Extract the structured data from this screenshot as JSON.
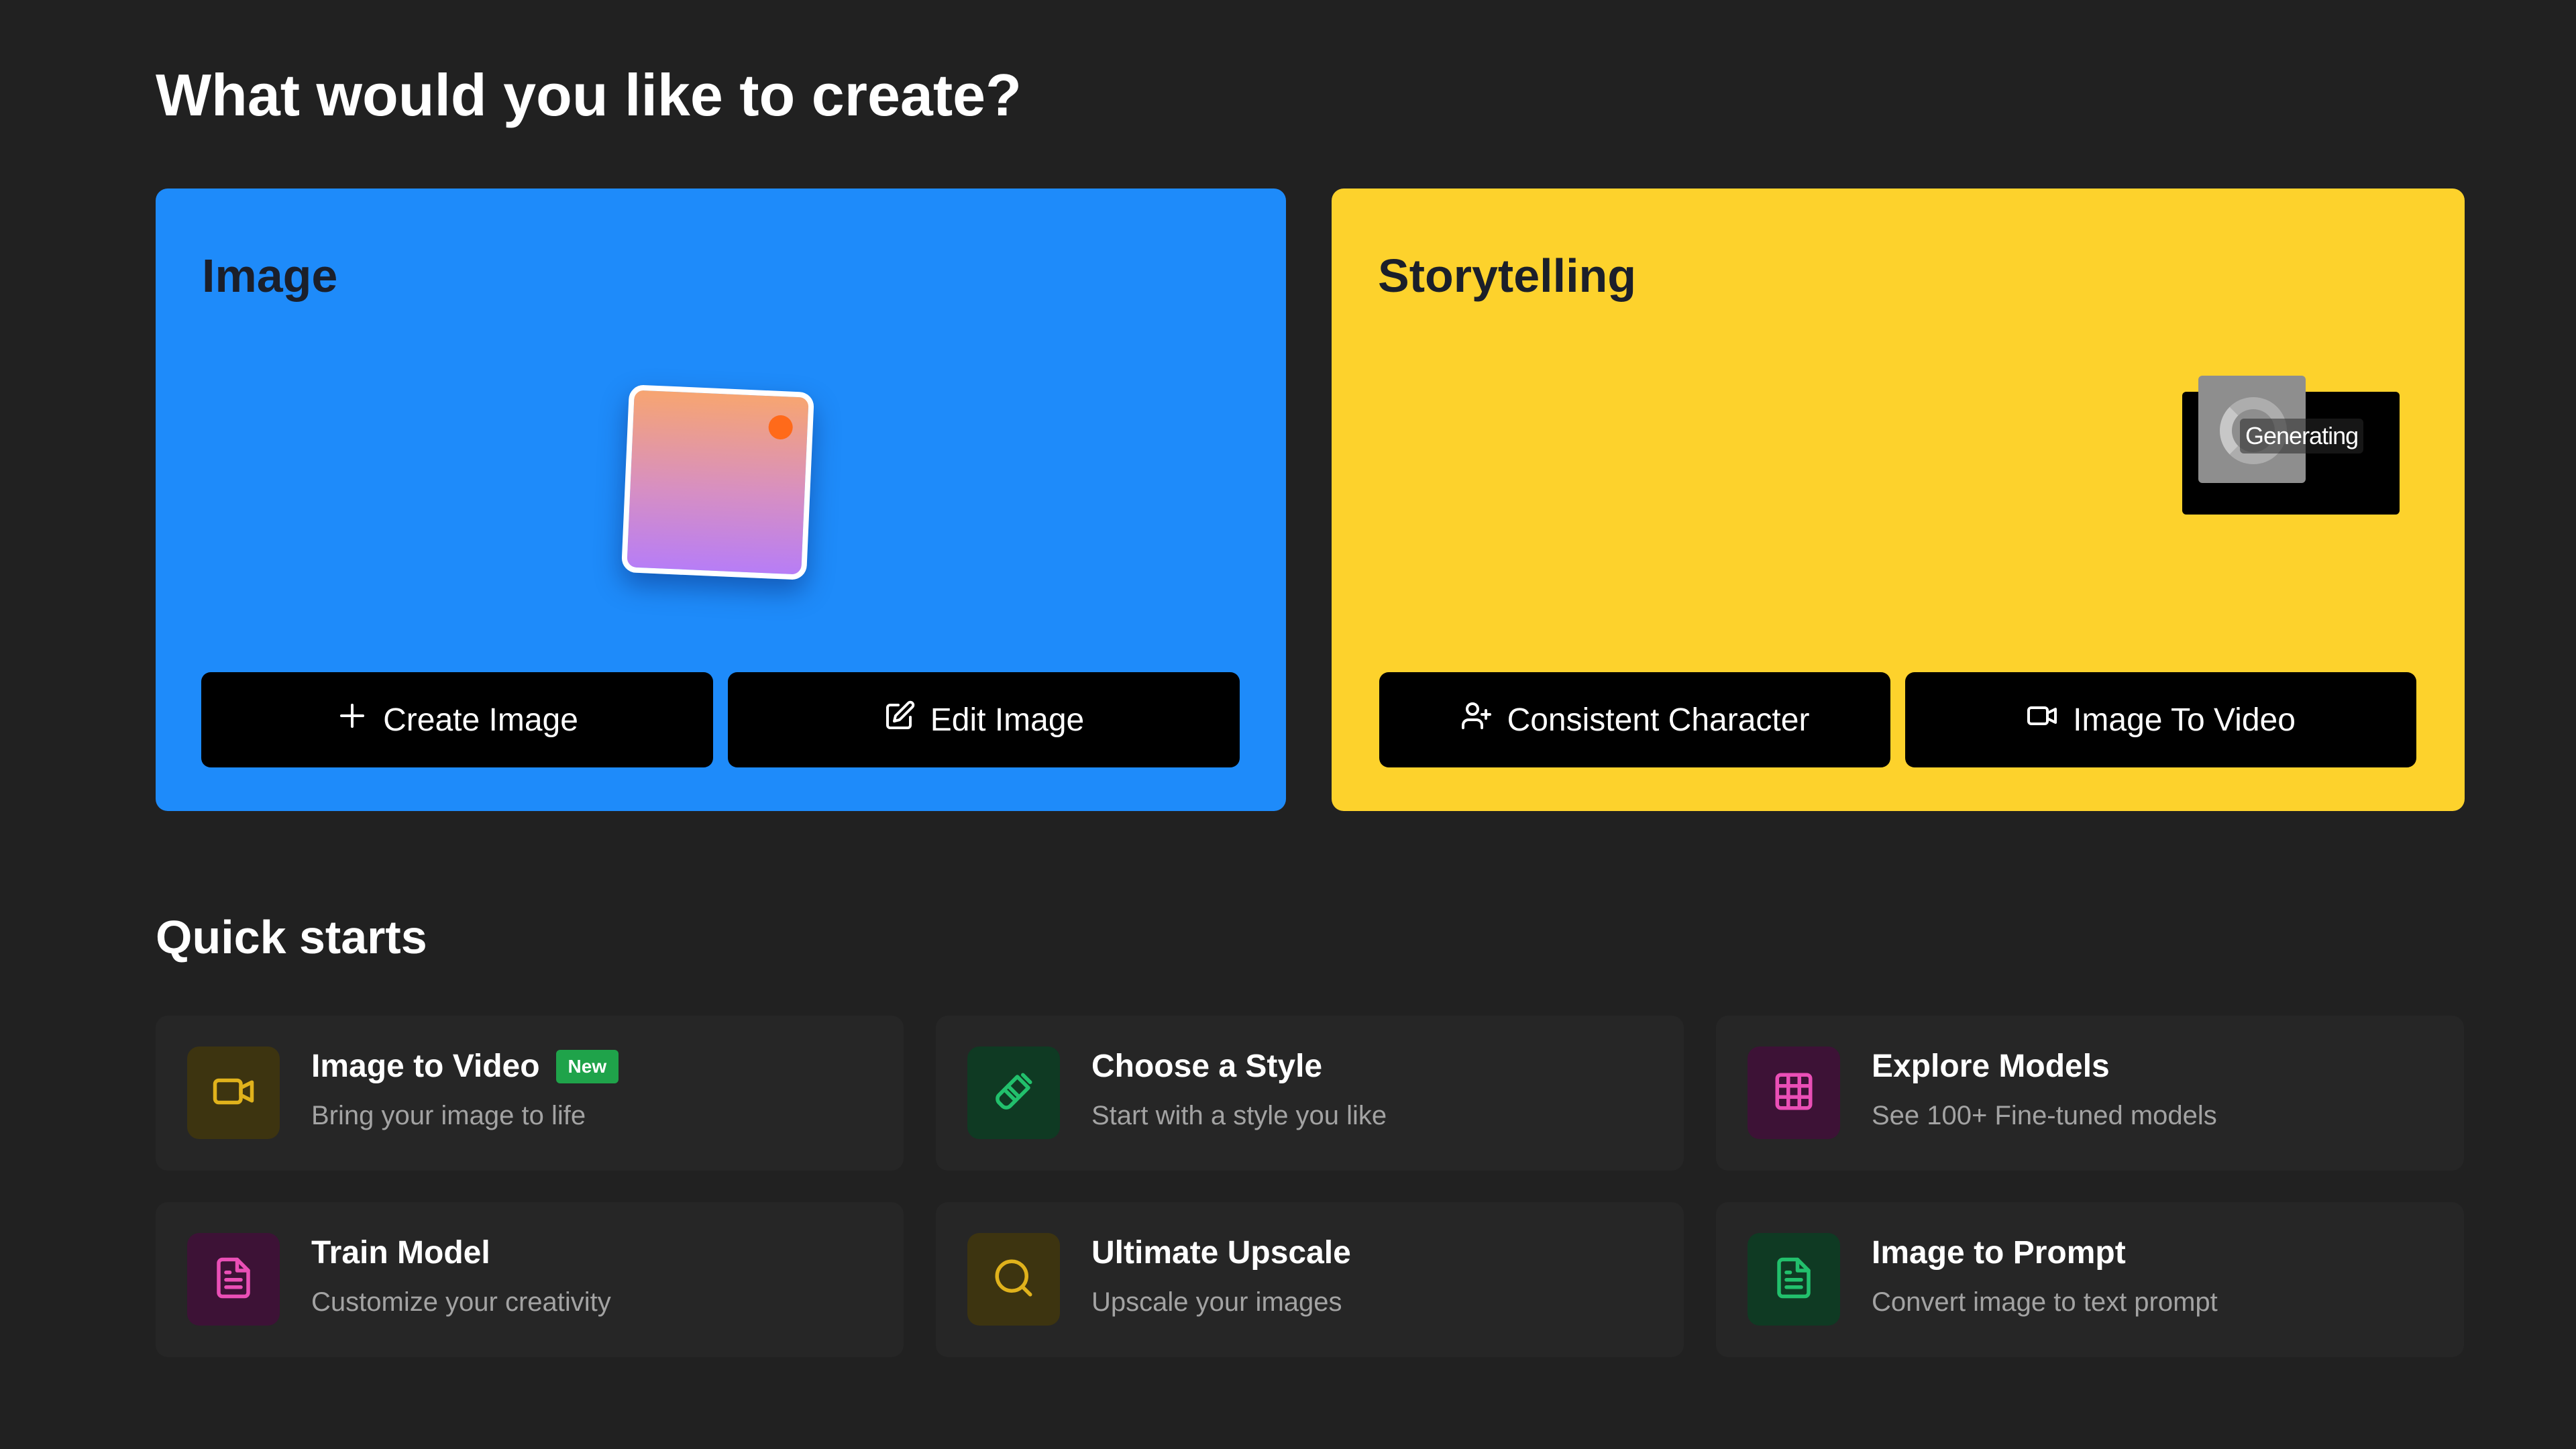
{
  "header": {
    "title": "What would you like to create?"
  },
  "image_card": {
    "title": "Image",
    "color": "#1e8bfa",
    "buttons": [
      {
        "label": "Create Image",
        "icon": "plus-icon"
      },
      {
        "label": "Edit Image",
        "icon": "edit-icon"
      }
    ]
  },
  "story_card": {
    "title": "Storytelling",
    "color": "#fdd22c",
    "status": "Generating",
    "buttons": [
      {
        "label": "Consistent Character",
        "icon": "user-plus-icon"
      },
      {
        "label": "Image To Video",
        "icon": "video-icon"
      }
    ]
  },
  "quick_starts": {
    "title": "Quick starts",
    "items": [
      {
        "title": "Image to Video",
        "badge": "New",
        "subtitle": "Bring your image to life",
        "icon": "video-icon",
        "icon_color": "#e0b21c",
        "icon_bg": "#3d3410"
      },
      {
        "title": "Choose a Style",
        "subtitle": "Start with a style you like",
        "icon": "paintbrush-icon",
        "icon_color": "#22c06c",
        "icon_bg": "#0f3a23"
      },
      {
        "title": "Explore Models",
        "subtitle": "See 100+ Fine-tuned models",
        "icon": "grid-icon",
        "icon_color": "#ea4fb6",
        "icon_bg": "#3d1236"
      },
      {
        "title": "Train Model",
        "subtitle": "Customize your creativity",
        "icon": "document-icon",
        "icon_color": "#ea4fb6",
        "icon_bg": "#3d1236"
      },
      {
        "title": "Ultimate Upscale",
        "subtitle": "Upscale your images",
        "icon": "search-icon",
        "icon_color": "#e0b21c",
        "icon_bg": "#3d3410"
      },
      {
        "title": "Image to Prompt",
        "subtitle": "Convert image to text prompt",
        "icon": "document-icon",
        "icon_color": "#22c06c",
        "icon_bg": "#0f3a23"
      }
    ]
  }
}
